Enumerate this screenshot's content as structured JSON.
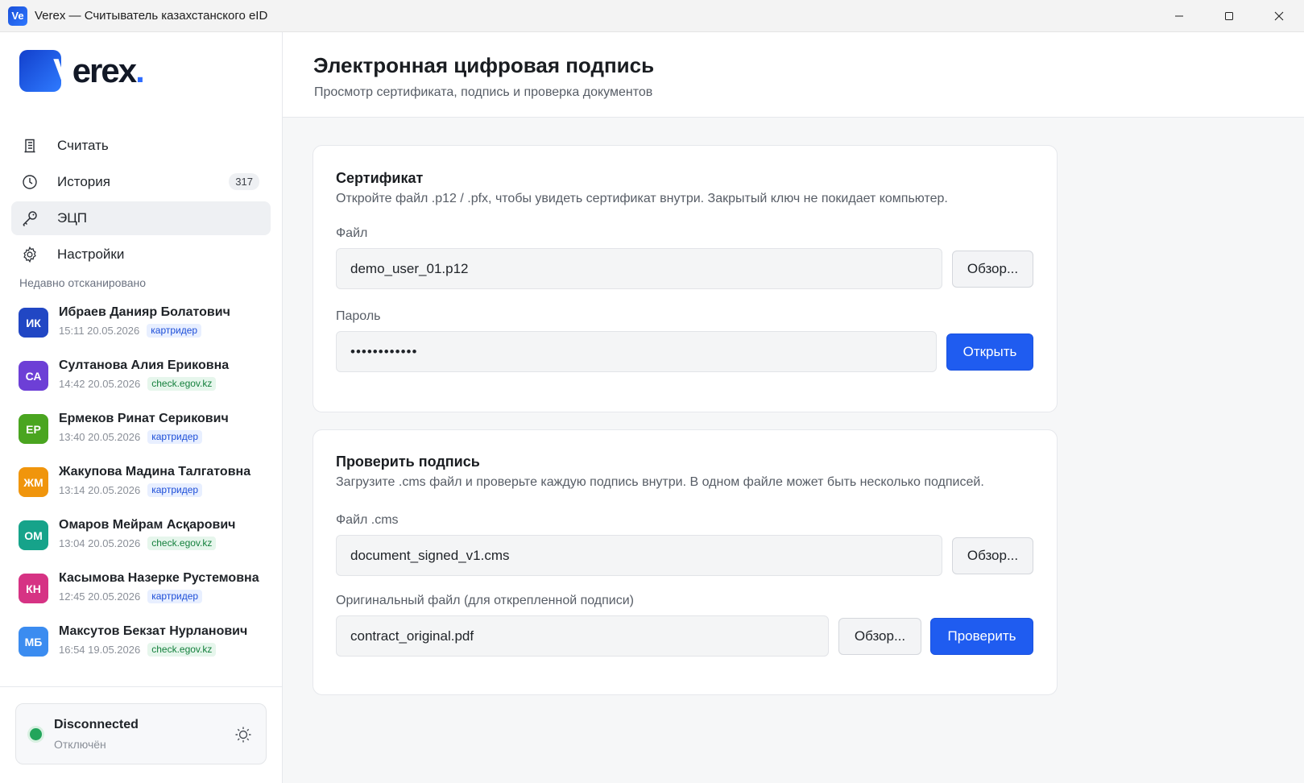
{
  "window": {
    "title": "Verex — Считыватель казахстанского eID",
    "app_icon_text": "Ve"
  },
  "logo": {
    "v": "V",
    "rest": "erex",
    "dot": "."
  },
  "nav": {
    "items": [
      {
        "label": "Считать",
        "icon": "reader-icon"
      },
      {
        "label": "История",
        "icon": "clock-icon",
        "badge": "317"
      },
      {
        "label": "ЭЦП",
        "icon": "key-icon",
        "active": true
      },
      {
        "label": "Настройки",
        "icon": "gear-icon"
      }
    ]
  },
  "recent": {
    "title": "Недавно отсканировано",
    "items": [
      {
        "initials": "ИК",
        "name": "Ибраев Данияр Болатович",
        "time": "15:11 20.05.2026",
        "source": "картридер",
        "color": "#2147c4"
      },
      {
        "initials": "СА",
        "name": "Султанова Алия Ериковна",
        "time": "14:42 20.05.2026",
        "source": "check.egov.kz",
        "color": "#6d3fd6"
      },
      {
        "initials": "ЕР",
        "name": "Ермеков Ринат Серикович",
        "time": "13:40 20.05.2026",
        "source": "картридер",
        "color": "#4aa520"
      },
      {
        "initials": "ЖМ",
        "name": "Жакупова Мадина Талгатовна",
        "time": "13:14 20.05.2026",
        "source": "картридер",
        "color": "#f0950c"
      },
      {
        "initials": "ОМ",
        "name": "Омаров Мейрам Асқарович",
        "time": "13:04 20.05.2026",
        "source": "check.egov.kz",
        "color": "#16a38a"
      },
      {
        "initials": "КН",
        "name": "Касымова Назерке Рустемовна",
        "time": "12:45 20.05.2026",
        "source": "картридер",
        "color": "#d63384"
      },
      {
        "initials": "МБ",
        "name": "Максутов Бекзат Нурланович",
        "time": "16:54 19.05.2026",
        "source": "check.egov.kz",
        "color": "#3b8cf0"
      }
    ]
  },
  "status": {
    "title": "Disconnected",
    "subtitle": "Отключён",
    "dot_color": "#22a55b"
  },
  "header": {
    "title": "Электронная цифровая подпись",
    "subtitle": "Просмотр сертификата, подпись и проверка документов"
  },
  "certificate": {
    "title": "Сертификат",
    "description": "Откройте файл .p12 / .pfx, чтобы увидеть сертификат внутри. Закрытый ключ не покидает компьютер.",
    "file_label": "Файл",
    "file_value": "demo_user_01.p12",
    "browse_label": "Обзор...",
    "password_label": "Пароль",
    "password_value": "••••••••••••",
    "open_label": "Открыть"
  },
  "verify": {
    "title": "Проверить подпись",
    "description": "Загрузите .cms файл и проверьте каждую подпись внутри. В одном файле может быть несколько подписей.",
    "cms_label": "Файл .cms",
    "cms_value": "document_signed_v1.cms",
    "cms_browse_label": "Обзор...",
    "original_label": "Оригинальный файл (для открепленной подписи)",
    "original_value": "contract_original.pdf",
    "original_browse_label": "Обзор...",
    "verify_label": "Проверить"
  },
  "colors": {
    "primary": "#1f5cf0",
    "brand": "#2e6bff"
  }
}
